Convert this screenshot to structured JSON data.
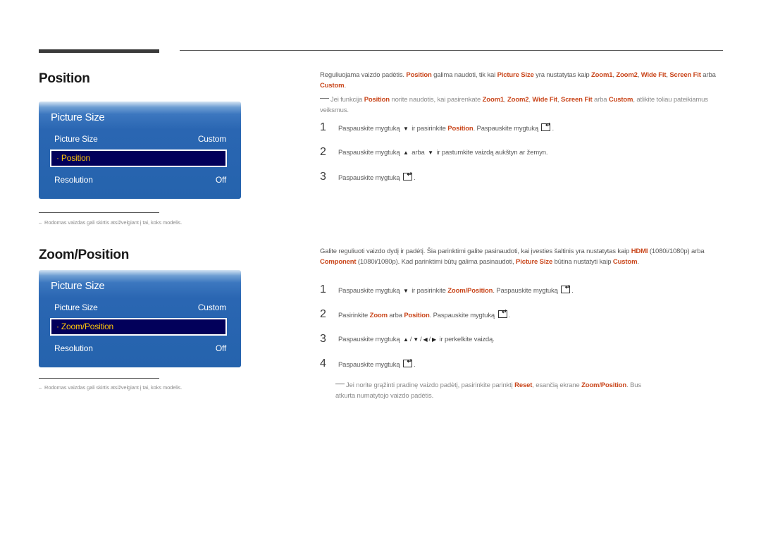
{
  "sections": [
    {
      "title": "Position",
      "osd": {
        "title": "Picture Size",
        "rows": [
          {
            "label": "Picture Size",
            "value": "Custom"
          },
          {
            "label": "· Position",
            "value": "",
            "selected": true
          },
          {
            "label": "Resolution",
            "value": "Off"
          }
        ]
      },
      "footnote": "Rodomas vaizdas gali skirtis atsižvelgiant į tai, koks modelis.",
      "intro": [
        {
          "t": "Reguliuojama vaizdo padėtis. "
        },
        {
          "t": "Position",
          "hl": true
        },
        {
          "t": " galima naudoti, tik kai "
        },
        {
          "t": "Picture Size",
          "hl": true
        },
        {
          "t": " yra nustatytas kaip "
        },
        {
          "t": "Zoom1",
          "hl": true
        },
        {
          "t": ", "
        },
        {
          "t": "Zoom2",
          "hl": true
        },
        {
          "t": ", "
        },
        {
          "t": "Wide Fit",
          "hl": true
        },
        {
          "t": ", "
        },
        {
          "t": "Screen Fit",
          "hl": true
        },
        {
          "t": " arba "
        },
        {
          "t": "Custom",
          "hl": true
        },
        {
          "t": "."
        }
      ],
      "note": [
        {
          "t": "Jei funkcija "
        },
        {
          "t": "Position",
          "hl": true
        },
        {
          "t": " norite naudotis, kai pasirenkate "
        },
        {
          "t": "Zoom1",
          "hl": true
        },
        {
          "t": ", "
        },
        {
          "t": "Zoom2",
          "hl": true
        },
        {
          "t": ", "
        },
        {
          "t": "Wide Fit",
          "hl": true
        },
        {
          "t": ", "
        },
        {
          "t": "Screen Fit",
          "hl": true
        },
        {
          "t": " arba "
        },
        {
          "t": "Custom",
          "hl": true
        },
        {
          "t": ", atlikite toliau pateikiamus veiksmus."
        }
      ],
      "steps": [
        {
          "num": "1",
          "parts": [
            {
              "t": "Paspauskite mygtuką "
            },
            {
              "icon": "down"
            },
            {
              "t": " ir pasirinkite "
            },
            {
              "t": "Position",
              "hl": true
            },
            {
              "t": ". Paspauskite mygtuką "
            },
            {
              "icon": "enter"
            },
            {
              "t": "."
            }
          ]
        },
        {
          "num": "2",
          "parts": [
            {
              "t": "Paspauskite mygtuką "
            },
            {
              "icon": "up"
            },
            {
              "t": " arba "
            },
            {
              "icon": "down"
            },
            {
              "t": " ir pastumkite vaizdą aukštyn ar žemyn."
            }
          ]
        },
        {
          "num": "3",
          "parts": [
            {
              "t": "Paspauskite mygtuką "
            },
            {
              "icon": "enter"
            },
            {
              "t": "."
            }
          ]
        }
      ]
    },
    {
      "title": "Zoom/Position",
      "osd": {
        "title": "Picture Size",
        "rows": [
          {
            "label": "Picture Size",
            "value": "Custom"
          },
          {
            "label": "· Zoom/Position",
            "value": "",
            "selected": true
          },
          {
            "label": "Resolution",
            "value": "Off"
          }
        ]
      },
      "footnote": "Rodomas vaizdas gali skirtis atsižvelgiant į tai, koks modelis.",
      "intro": [
        {
          "t": "Galite reguliuoti vaizdo dydį ir padėtį. Šia parinktimi galite pasinaudoti, kai įvesties šaltinis yra nustatytas kaip "
        },
        {
          "t": "HDMI",
          "hl": true
        },
        {
          "t": " (1080i/1080p) arba "
        },
        {
          "t": "Component",
          "hl": true
        },
        {
          "t": " (1080i/1080p). Kad parinktimi būtų galima pasinaudoti, "
        },
        {
          "t": "Picture Size",
          "hl": true
        },
        {
          "t": " būtina nustatyti kaip "
        },
        {
          "t": "Custom",
          "hl": true
        },
        {
          "t": "."
        }
      ],
      "steps": [
        {
          "num": "1",
          "parts": [
            {
              "t": "Paspauskite mygtuką "
            },
            {
              "icon": "down"
            },
            {
              "t": " ir pasirinkite "
            },
            {
              "t": "Zoom/Position",
              "hl": true
            },
            {
              "t": ". Paspauskite mygtuką "
            },
            {
              "icon": "enter"
            },
            {
              "t": "."
            }
          ]
        },
        {
          "num": "2",
          "parts": [
            {
              "t": "Pasirinkite "
            },
            {
              "t": "Zoom",
              "hl": true
            },
            {
              "t": " arba "
            },
            {
              "t": "Position",
              "hl": true
            },
            {
              "t": ". Paspauskite mygtuką "
            },
            {
              "icon": "enter"
            },
            {
              "t": "."
            }
          ]
        },
        {
          "num": "3",
          "parts": [
            {
              "t": "Paspauskite mygtuką "
            },
            {
              "icon": "up"
            },
            {
              "t": "/"
            },
            {
              "icon": "down"
            },
            {
              "t": "/"
            },
            {
              "icon": "left"
            },
            {
              "t": "/"
            },
            {
              "icon": "right"
            },
            {
              "t": " ir perkelkite vaizdą."
            }
          ]
        },
        {
          "num": "4",
          "parts": [
            {
              "t": "Paspauskite mygtuką "
            },
            {
              "icon": "enter"
            },
            {
              "t": "."
            }
          ]
        }
      ],
      "note": [
        {
          "t": "Jei norite grąžinti pradinę vaizdo padėtį, pasirinkite parinktį "
        },
        {
          "t": "Reset",
          "hl": true
        },
        {
          "t": ", esančią ekrane "
        },
        {
          "t": "Zoom/Position",
          "hl": true
        },
        {
          "t": ". Bus atkurta numatytojo vaizdo padėtis."
        }
      ]
    }
  ],
  "colors": {
    "highlight": "#c9461b",
    "osd_blue": "#2563ad",
    "osd_selected": "#02005a",
    "osd_selected_text": "#ffc60a"
  },
  "icons": {
    "down": "▼",
    "up": "▲",
    "left": "◀",
    "right": "▶"
  }
}
